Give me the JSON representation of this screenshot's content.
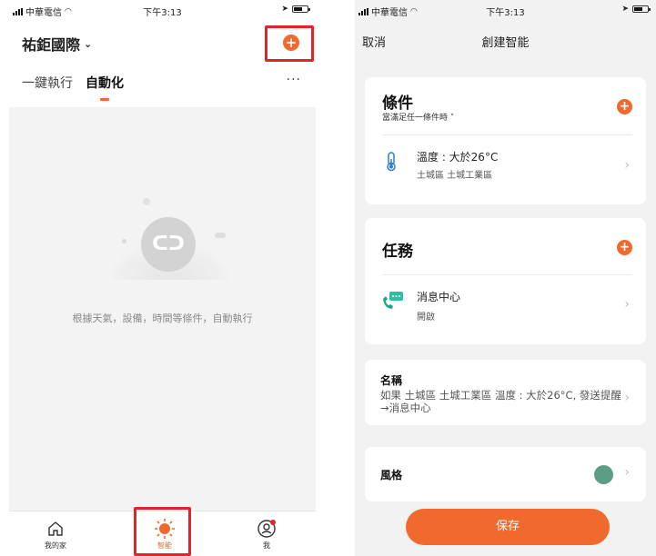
{
  "left": {
    "status": {
      "carrier": "中華電信",
      "time": "下午3:13"
    },
    "home_name": "祐鉅國際",
    "tabs": [
      {
        "label": "一鍵執行"
      },
      {
        "label": "自動化"
      }
    ],
    "more_label": "···",
    "empty_text": "根據天氣，設備，時間等條件，自動執行",
    "tabbar": [
      {
        "label": "我的家",
        "icon": "home-icon"
      },
      {
        "label": "智能",
        "icon": "sun-icon"
      },
      {
        "label": "我",
        "icon": "profile-icon"
      }
    ],
    "colors": {
      "accent": "#f06a2e",
      "highlight": "#e0242a"
    }
  },
  "right": {
    "status": {
      "carrier": "中華電信",
      "time": "下午3:13"
    },
    "nav": {
      "cancel": "取消",
      "title": "創建智能"
    },
    "condition": {
      "title": "條件",
      "subtitle": "當滿足任一條件時",
      "item_main": "溫度 : 大於26°C",
      "item_sub": "土城區 土城工業區",
      "icon": "thermometer-icon"
    },
    "task": {
      "title": "任務",
      "item_main": "消息中心",
      "item_sub": "開啟",
      "icon": "message-icon"
    },
    "name": {
      "label": "名稱",
      "value": "如果 土城區 土城工業區 溫度 : 大於26°C, 發送提醒→消息中心"
    },
    "style": {
      "label": "風格",
      "color": "#5b9e85"
    },
    "save_label": "保存"
  }
}
